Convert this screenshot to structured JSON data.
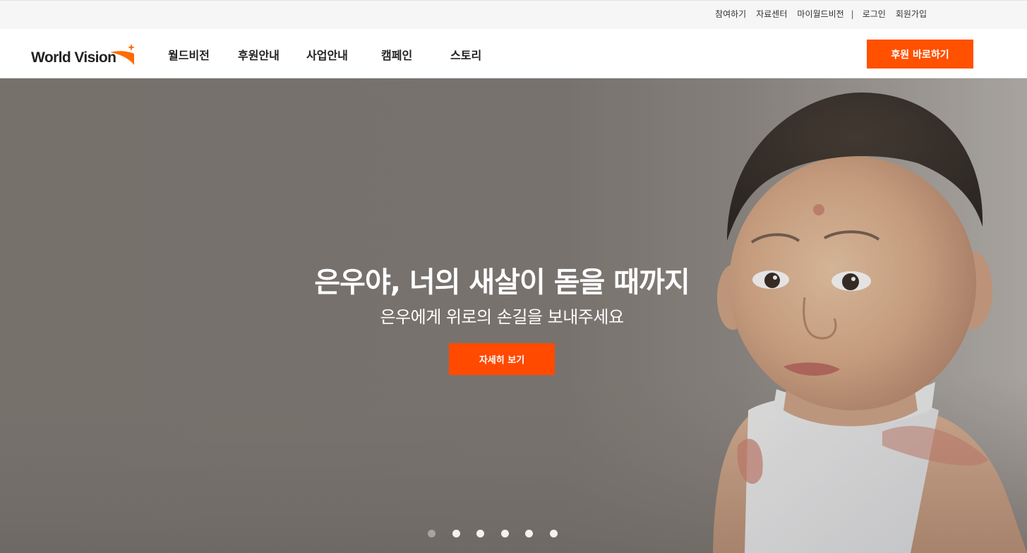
{
  "utility": {
    "links": [
      "참여하기",
      "자료센터",
      "마이월드비전",
      "로그인",
      "회원가입"
    ],
    "separator": "|"
  },
  "header": {
    "logo_text": "World Vision",
    "nav": [
      "월드비전",
      "후원안내",
      "사업안내",
      "캠페인",
      "스토리"
    ],
    "donate_label": "후원 바로하기"
  },
  "hero": {
    "title": "은우야, 너의 새살이 돋을 때까지",
    "subtitle": "은우에게 위로의 손길을 보내주세요",
    "cta_label": "자세히 보기",
    "slide_count": 6,
    "active_slide": 1
  },
  "colors": {
    "brand_orange": "#ff5100",
    "cta_orange": "#ff4a00",
    "hero_overlay": "#7b7571"
  },
  "icons": [
    "world-vision-star-icon"
  ]
}
